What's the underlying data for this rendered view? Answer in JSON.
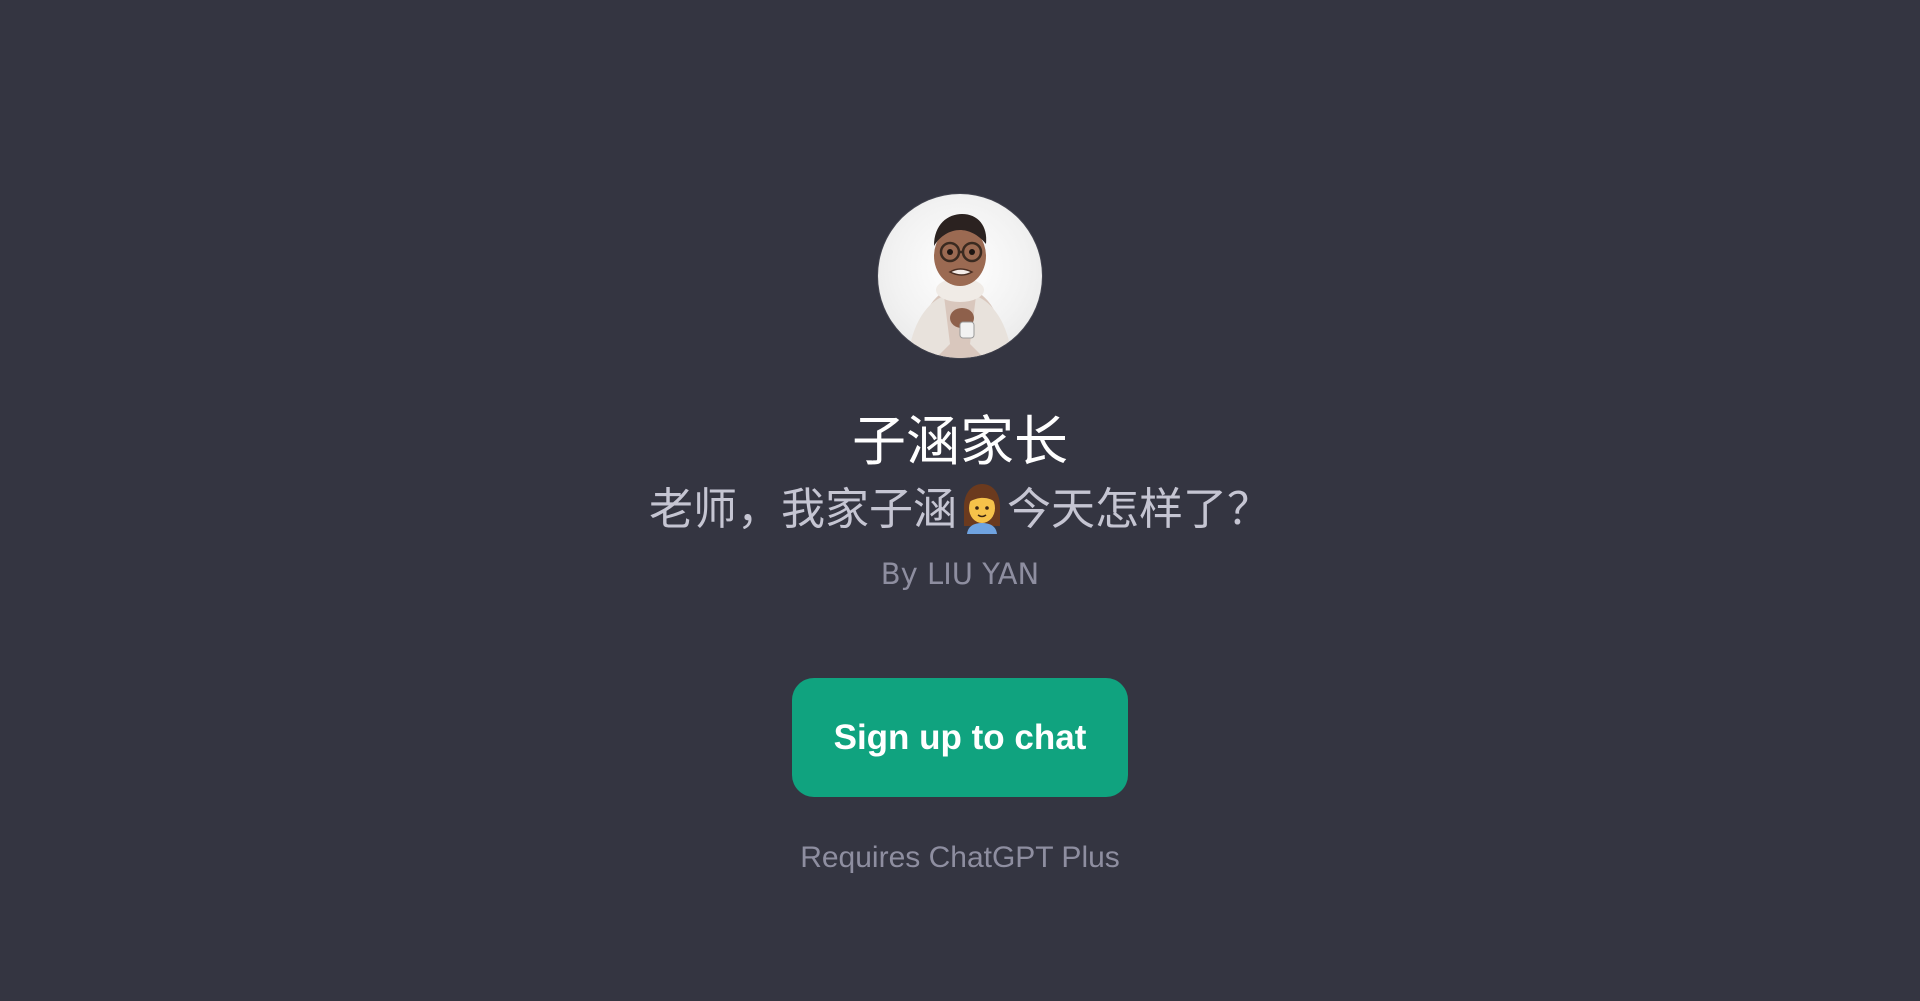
{
  "gpt": {
    "name": "子涵家长",
    "description_before_emoji": "老师，我家子涵",
    "description_emoji": "woman-emoji",
    "description_after_emoji": "今天怎样了？",
    "author": "By LIU YAN"
  },
  "actions": {
    "signup_label": "Sign up to chat",
    "requirement_note": "Requires ChatGPT Plus"
  },
  "colors": {
    "background": "#343541",
    "accent": "#10a37f",
    "title": "#ffffff",
    "subtitle": "#c5c5d2",
    "muted": "#8e8ea0"
  }
}
